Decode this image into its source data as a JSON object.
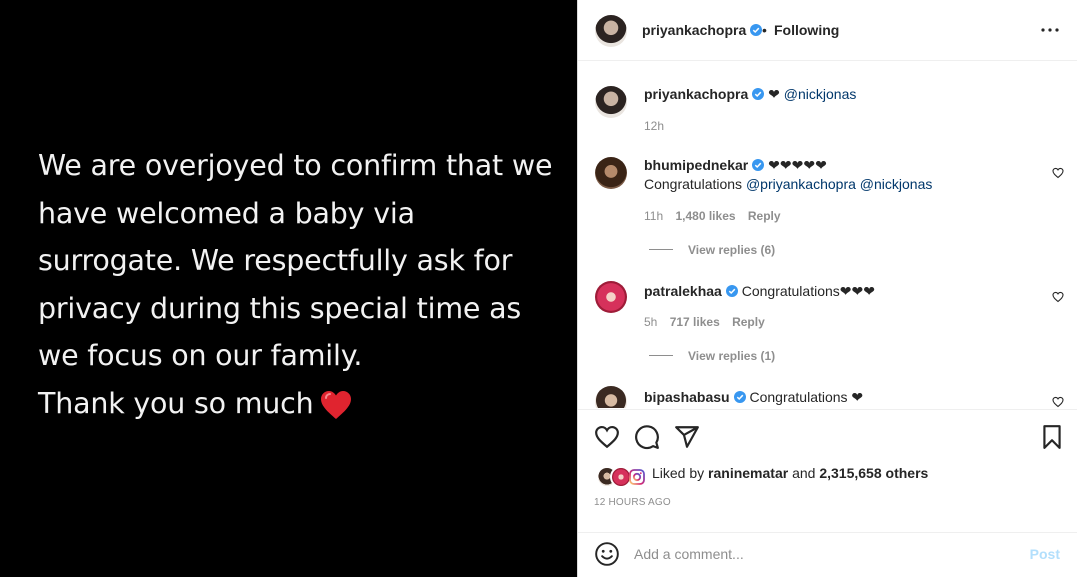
{
  "media": {
    "lines": [
      "We are overjoyed to confirm that we",
      "have welcomed a baby via",
      "surrogate. We respectfully ask for",
      "privacy during this special time as",
      "we focus on our family.",
      "Thank you so much"
    ]
  },
  "header": {
    "username": "priyankachopra",
    "separator": "•",
    "following": "Following"
  },
  "caption": {
    "username": "priyankachopra",
    "heart": "❤",
    "mention": "@nickjonas",
    "time": "12h"
  },
  "comments": [
    {
      "username": "bhumipednekar",
      "text_first": "❤❤❤❤❤",
      "text_second_plain": "Congratulations",
      "mention1": "@priyankachopra",
      "mention2": "@nickjonas",
      "time": "11h",
      "likes": "1,480 likes",
      "reply": "Reply",
      "view_replies": "View replies (6)"
    },
    {
      "username": "patralekhaa",
      "text": "Congratulations❤❤❤",
      "time": "5h",
      "likes": "717 likes",
      "reply": "Reply",
      "view_replies": "View replies (1)"
    },
    {
      "username": "bipashabasu",
      "text": "Congratulations ❤"
    }
  ],
  "likes": {
    "prefix": "Liked by",
    "user": "raninematar",
    "and": "and",
    "others": "2,315,658 others"
  },
  "timestamp": "12 HOURS AGO",
  "add_comment": {
    "placeholder": "Add a comment...",
    "post": "Post"
  },
  "colors": {
    "verified": "#3897f0",
    "mention": "#00376b",
    "post_disabled": "#b2dffc"
  },
  "icons": [
    "more-options-icon",
    "heart-icon",
    "comment-icon",
    "share-icon",
    "bookmark-icon",
    "emoji-icon",
    "verified-badge-icon"
  ]
}
